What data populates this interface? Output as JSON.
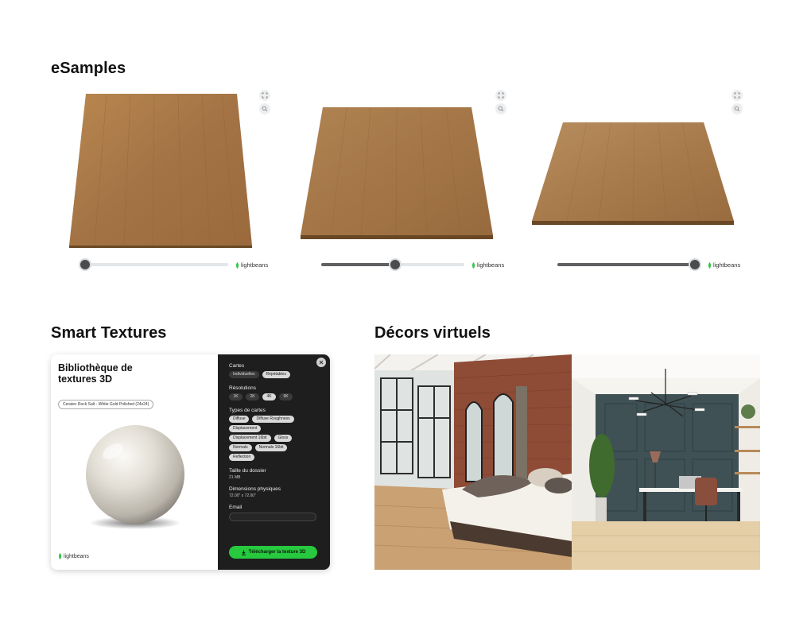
{
  "sections": {
    "esamples_title": "eSamples",
    "smart_title": "Smart Textures",
    "decors_title": "Décors virtuels"
  },
  "esamples": [
    {
      "slider_fraction": 0.0,
      "brand": "lightbeans"
    },
    {
      "slider_fraction": 0.52,
      "brand": "lightbeans"
    },
    {
      "slider_fraction": 1.0,
      "brand": "lightbeans"
    }
  ],
  "icons": {
    "expand": "expand-icon",
    "zoom": "zoom-icon",
    "close": "close-icon",
    "download": "download-icon",
    "brand_leaf": "leaf-icon"
  },
  "smart_textures": {
    "title": "Bibliothèque de textures 3D",
    "material": "Ceratec Rock Salt - White Gold Polished (24x24)",
    "brand": "lightbeans",
    "cartes_label": "Cartes",
    "cartes": [
      {
        "label": "Individuelles",
        "selected": false
      },
      {
        "label": "Répétables",
        "selected": true
      }
    ],
    "resolutions_label": "Résolutions",
    "resolutions": [
      {
        "label": "1K",
        "selected": false
      },
      {
        "label": "2K",
        "selected": false
      },
      {
        "label": "4K",
        "selected": true
      },
      {
        "label": "6K",
        "selected": false
      }
    ],
    "map_types_label": "Types de cartes",
    "map_types": [
      "Diffuse",
      "Diffuse Roughness",
      "Displacement",
      "Displacement 16bit",
      "Gloss",
      "Normals",
      "Normals 16bit",
      "Reflection"
    ],
    "size_label": "Taille du dossier",
    "size_value": "21 MB",
    "dims_label": "Dimensions physiques",
    "dims_value": "72.00\" x 72.00\"",
    "email_label": "Email",
    "download_label": "Télécharger la texture 3D"
  },
  "colors": {
    "accent_green": "#27c93f",
    "panel_dark": "#1e1e1e",
    "wood": "#a7794a"
  }
}
